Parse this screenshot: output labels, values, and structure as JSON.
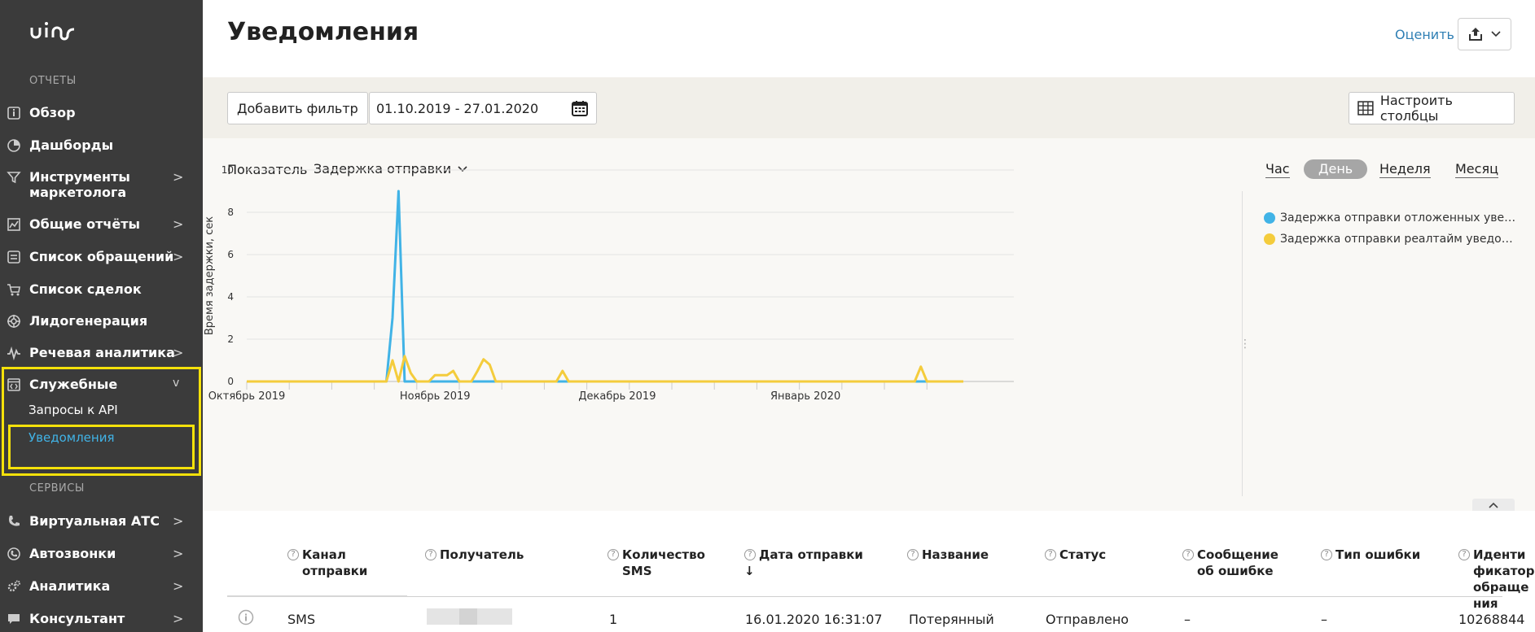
{
  "sidebar": {
    "reports_title": "ОТЧЕТЫ",
    "items": [
      {
        "label": "Обзор",
        "icon": "info-icon",
        "arrow": ""
      },
      {
        "label": "Дашборды",
        "icon": "pie-chart-icon",
        "arrow": ""
      },
      {
        "label": "Инструменты маркетолога",
        "icon": "filter-icon",
        "arrow": ">"
      },
      {
        "label": "Общие отчёты",
        "icon": "line-chart-icon",
        "arrow": ">"
      },
      {
        "label": "Список обращений",
        "icon": "list-icon",
        "arrow": ">"
      },
      {
        "label": "Список сделок",
        "icon": "cart-icon",
        "arrow": ""
      },
      {
        "label": "Лидогенерация",
        "icon": "lifebuoy-icon",
        "arrow": ""
      },
      {
        "label": "Речевая аналитика",
        "icon": "waveform-icon",
        "arrow": ">"
      },
      {
        "label": "Служебные",
        "icon": "code-window-icon",
        "arrow": "v"
      }
    ],
    "sub_items": [
      {
        "label": "Запросы к API"
      },
      {
        "label": "Уведомления"
      }
    ],
    "services_title": "СЕРВИСЫ",
    "service_items": [
      {
        "label": "Виртуальная АТС",
        "icon": "phone-icon",
        "arrow": ">"
      },
      {
        "label": "Автозвонки",
        "icon": "auto-call-icon",
        "arrow": ">"
      },
      {
        "label": "Аналитика",
        "icon": "gears-icon",
        "arrow": ">"
      },
      {
        "label": "Консультант",
        "icon": "chat-icon",
        "arrow": ">"
      }
    ],
    "accent_color": "#41b3e6",
    "highlight_color": "#f5e10a"
  },
  "header": {
    "title": "Уведомления",
    "rate_label": "Оценить"
  },
  "toolbar": {
    "add_filter_label": "Добавить фильтр",
    "date_range": "01.10.2019 - 27.01.2020",
    "configure_columns_label": "Настроить столбцы"
  },
  "chart_controls": {
    "metric_label": "Показатель",
    "metric_value": "Задержка отправки",
    "periods": [
      "Час",
      "День",
      "Неделя",
      "Месяц"
    ],
    "active_period": "День"
  },
  "chart_data": {
    "type": "line",
    "ylabel": "Время задержки, сек",
    "ylim": [
      0,
      10
    ],
    "yticks": [
      0,
      2,
      4,
      6,
      8,
      10
    ],
    "xticks": [
      "Октябрь 2019",
      "Ноябрь 2019",
      "Декабрь 2019",
      "Январь 2020"
    ],
    "x_start": "2019-10-01",
    "x_end": "2020-01-27",
    "grid": true,
    "legend_position": "right",
    "series": [
      {
        "name": "Задержка отправки отложенных уведомлений",
        "color": "#41b3e6",
        "points": [
          [
            "2019-10-01",
            0
          ],
          [
            "2019-10-24",
            0
          ],
          [
            "2019-10-25",
            3
          ],
          [
            "2019-10-26",
            9
          ],
          [
            "2019-10-27",
            0
          ],
          [
            "2020-01-27",
            0
          ]
        ]
      },
      {
        "name": "Задержка отправки реалтайм уведомлений",
        "color": "#f4cc3c",
        "points": [
          [
            "2019-10-01",
            0
          ],
          [
            "2019-10-24",
            0
          ],
          [
            "2019-10-25",
            1
          ],
          [
            "2019-10-26",
            0
          ],
          [
            "2019-10-27",
            1.2
          ],
          [
            "2019-10-28",
            0.4
          ],
          [
            "2019-10-29",
            0
          ],
          [
            "2019-10-31",
            0
          ],
          [
            "2019-11-01",
            0.3
          ],
          [
            "2019-11-02",
            0.3
          ],
          [
            "2019-11-03",
            0.3
          ],
          [
            "2019-11-04",
            0.5
          ],
          [
            "2019-11-05",
            0
          ],
          [
            "2019-11-07",
            0
          ],
          [
            "2019-11-08",
            0.5
          ],
          [
            "2019-11-09",
            1.05
          ],
          [
            "2019-11-10",
            0.8
          ],
          [
            "2019-11-11",
            0
          ],
          [
            "2019-11-21",
            0
          ],
          [
            "2019-11-22",
            0.5
          ],
          [
            "2019-11-23",
            0
          ],
          [
            "2020-01-19",
            0
          ],
          [
            "2020-01-20",
            0.7
          ],
          [
            "2020-01-21",
            0
          ],
          [
            "2020-01-27",
            0
          ]
        ]
      }
    ]
  },
  "legend": [
    {
      "label": "Задержка отправки отложенных уведомлений",
      "color": "#41b3e6"
    },
    {
      "label": "Задержка отправки реалтайм уведомлений",
      "color": "#f4cc3c"
    }
  ],
  "table": {
    "columns": [
      {
        "label": "Канал отправки"
      },
      {
        "label": "Получатель"
      },
      {
        "label": "Количество SMS"
      },
      {
        "label": "Дата отправки",
        "sort": "↓"
      },
      {
        "label": "Название"
      },
      {
        "label": "Статус"
      },
      {
        "label": "Сообщение об ошибке"
      },
      {
        "label": "Тип ошибки"
      },
      {
        "label": "Идентификатор обращения"
      }
    ],
    "rows": [
      {
        "channel": "SMS",
        "recipient": "",
        "sms_count": "1",
        "date": "16.01.2020 16:31:07",
        "name": "Потерянный",
        "status": "Отправлено",
        "error_message": "–",
        "error_type": "–",
        "request_id": "10268844"
      }
    ]
  }
}
